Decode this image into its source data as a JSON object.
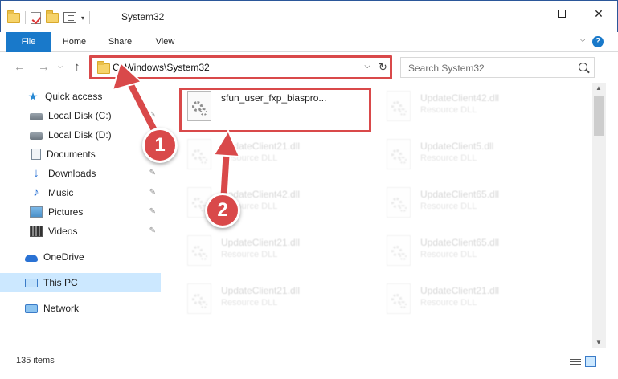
{
  "window": {
    "title": "System32",
    "qat_dropdown": "▾",
    "minimize": "",
    "maximize": "",
    "close": "✕"
  },
  "ribbon": {
    "tabs": [
      {
        "label": "File",
        "active": true
      },
      {
        "label": "Home"
      },
      {
        "label": "Share"
      },
      {
        "label": "View"
      }
    ],
    "expand": "⌵",
    "help": "?"
  },
  "nav": {
    "back": "←",
    "forward": "→",
    "recent": "⌵",
    "up": "↑",
    "address": "C:\\Windows\\System32",
    "address_drop": "⌵",
    "refresh": "↻",
    "search_placeholder": "Search System32"
  },
  "sidebar": {
    "items": [
      {
        "label": "Quick access",
        "icon": "star-icon"
      },
      {
        "label": "Local Disk (C:)",
        "icon": "disk-icon",
        "pinned": true
      },
      {
        "label": "Local Disk (D:)",
        "icon": "disk-icon"
      },
      {
        "label": "Documents",
        "icon": "documents-icon",
        "pinned": true
      },
      {
        "label": "Downloads",
        "icon": "downloads-icon",
        "pinned": true
      },
      {
        "label": "Music",
        "icon": "music-icon",
        "pinned": true
      },
      {
        "label": "Pictures",
        "icon": "pictures-icon",
        "pinned": true
      },
      {
        "label": "Videos",
        "icon": "videos-icon",
        "pinned": true
      },
      {
        "label": "OneDrive",
        "icon": "onedrive-icon"
      },
      {
        "label": "This PC",
        "icon": "pc-icon",
        "selected": true
      },
      {
        "label": "Network",
        "icon": "network-icon"
      }
    ],
    "pin_glyph": "✎"
  },
  "files": [
    {
      "name": "sfun_user_fxp_biaspro...",
      "type": "",
      "highlight": true
    },
    {
      "name": "UpdateClient42.dll",
      "type": "Resource DLL"
    },
    {
      "name": "UpdateClient21.dll",
      "type": "Resource DLL"
    },
    {
      "name": "UpdateClient5.dll",
      "type": "Resource DLL"
    },
    {
      "name": "UpdateClient42.dll",
      "type": "Resource DLL"
    },
    {
      "name": "UpdateClient65.dll",
      "type": "Resource DLL"
    },
    {
      "name": "UpdateClient21.dll",
      "type": "Resource DLL"
    },
    {
      "name": "UpdateClient65.dll",
      "type": "Resource DLL"
    },
    {
      "name": "UpdateClient21.dll",
      "type": "Resource DLL"
    },
    {
      "name": "UpdateClient21.dll",
      "type": "Resource DLL"
    }
  ],
  "status": {
    "items_count": "135 items"
  },
  "scrollbar": {
    "up": "▲",
    "down": "▼"
  },
  "annotations": {
    "badge1": "1",
    "badge2": "2",
    "color": "#d9494a"
  }
}
